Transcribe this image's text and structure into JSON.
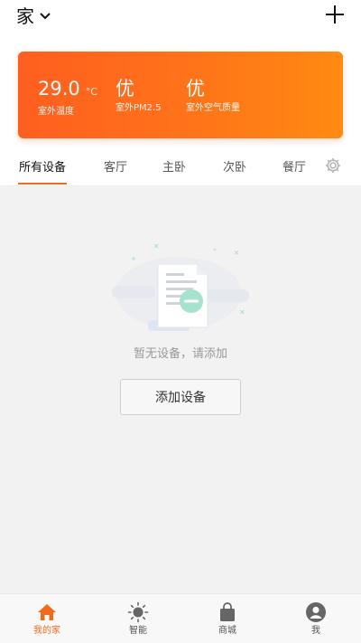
{
  "header": {
    "home_title": "家",
    "dropdown_icon": "chevron-down-icon",
    "add_icon": "plus-icon"
  },
  "weather": {
    "temperature": {
      "value": "29.0",
      "unit": "°C",
      "label": "室外温度"
    },
    "pm25": {
      "value": "优",
      "label": "室外PM2.5"
    },
    "air_quality": {
      "value": "优",
      "label": "室外空气质量"
    },
    "gradient_colors": [
      "#ff5e1f",
      "#ff8a12"
    ]
  },
  "tabs": {
    "items": [
      {
        "label": "所有设备",
        "active": true
      },
      {
        "label": "客厅",
        "active": false
      },
      {
        "label": "主卧",
        "active": false
      },
      {
        "label": "次卧",
        "active": false
      },
      {
        "label": "餐厅",
        "active": false
      }
    ],
    "settings_icon": "gear-icon"
  },
  "main": {
    "empty_text": "暂无设备，请添加",
    "add_button_label": "添加设备",
    "illustration": "empty-document-icon"
  },
  "bottom_nav": {
    "items": [
      {
        "label": "我的家",
        "icon": "home-icon",
        "active": true
      },
      {
        "label": "智能",
        "icon": "sun-icon",
        "active": false
      },
      {
        "label": "商城",
        "icon": "shopping-bag-icon",
        "active": false
      },
      {
        "label": "我",
        "icon": "user-icon",
        "active": false
      }
    ]
  },
  "colors": {
    "accent": "#f26b1d",
    "background": "#f2f2f2"
  }
}
